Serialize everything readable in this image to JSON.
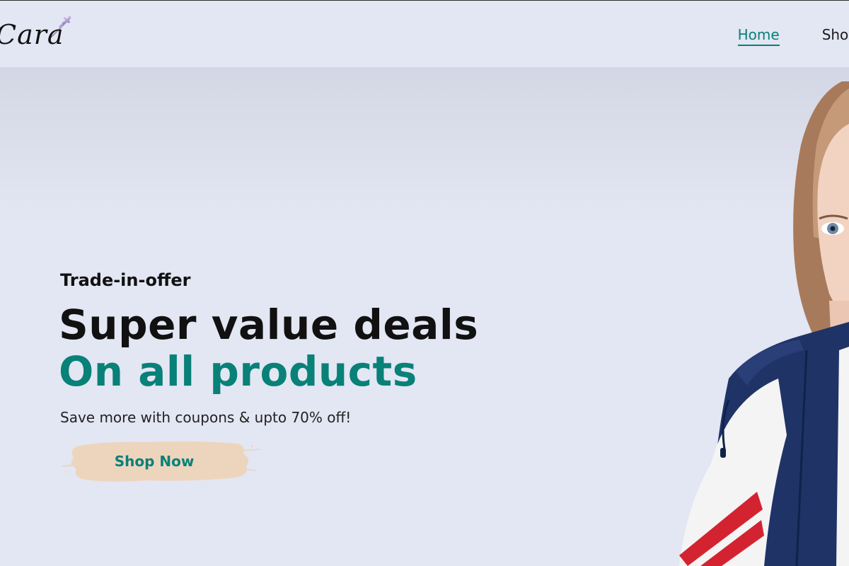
{
  "brand": {
    "logo_text": "Cara",
    "logo_icon": "lavender-sprig-icon"
  },
  "nav": {
    "items": [
      {
        "label": "Home",
        "active": true
      },
      {
        "label": "Shop",
        "active": false
      }
    ]
  },
  "hero": {
    "subtitle": "Trade-in-offer",
    "headline": "Super value deals",
    "highlight": "On all products",
    "description": "Save more with coupons & upto 70% off!",
    "cta_label": "Shop Now",
    "cta_background_icon": "brush-stroke-background"
  },
  "colors": {
    "accent": "#088178",
    "page_background": "#e3e6f3",
    "button_brush": "#edd5bd"
  }
}
